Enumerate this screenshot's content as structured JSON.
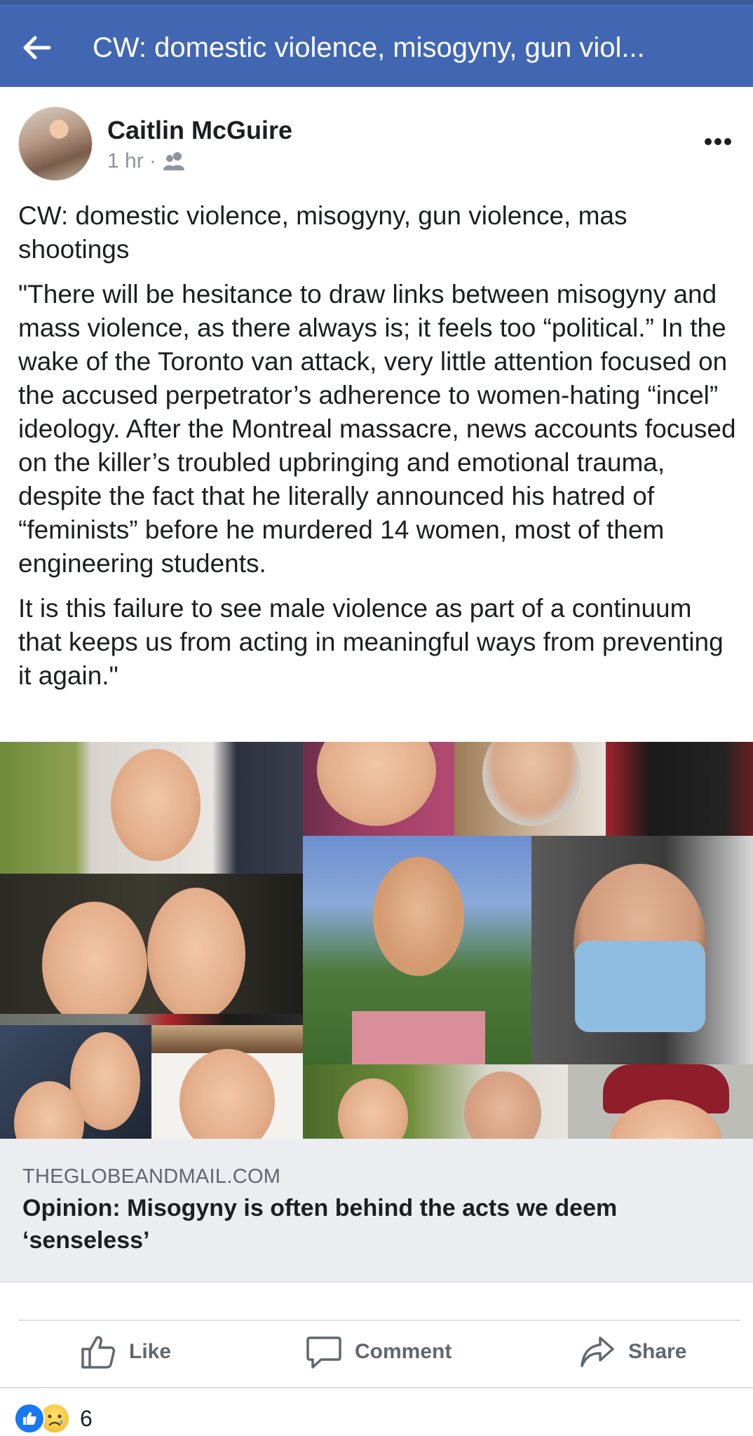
{
  "topbar": {
    "title": "CW: domestic violence, misogyny, gun viol..."
  },
  "post": {
    "author": "Caitlin McGuire",
    "time": "1 hr ·",
    "paragraphs": [
      "CW: domestic violence, misogyny, gun violence, mas shootings",
      "\"There will be hesitance to draw links between misogyny and mass violence, as there always is; it feels too “political.” In the wake of the Toronto van attack, very little attention focused on the accused perpetrator’s adherence to women-hating “incel” ideology. After the Montreal massacre, news accounts focused on the killer’s troubled upbringing and emotional trauma, despite the fact that he literally announced his hatred of “feminists” before he murdered 14 women, most of them engineering students.",
      "It is this failure to see male violence as part of a continuum that keeps us from acting in meaningful ways from preventing it again.\""
    ]
  },
  "link": {
    "domain": "THEGLOBEANDMAIL.COM",
    "title": "Opinion: Misogyny is often behind the acts we deem ‘senseless’"
  },
  "actions": {
    "like": "Like",
    "comment": "Comment",
    "share": "Share"
  },
  "reactions": {
    "count": "6"
  }
}
